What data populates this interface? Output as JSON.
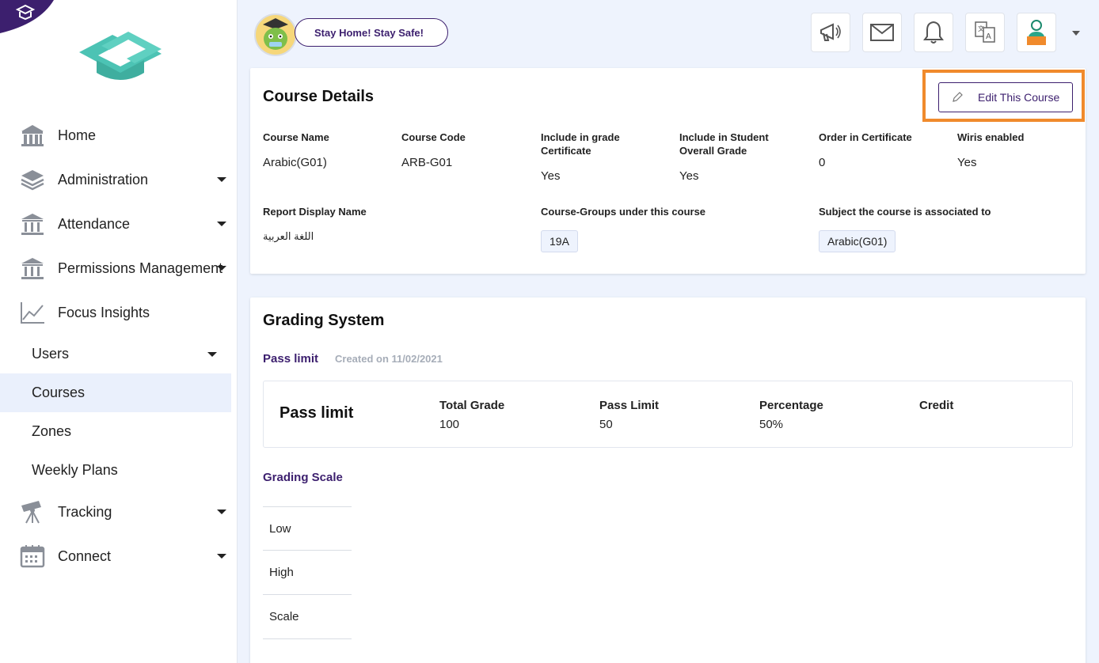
{
  "sidebar": {
    "items": [
      {
        "label": "Home",
        "icon": "bank-icon"
      },
      {
        "label": "Administration",
        "icon": "layers-icon"
      },
      {
        "label": "Attendance",
        "icon": "building-icon"
      },
      {
        "label": "Permissions Management",
        "icon": "building-icon"
      },
      {
        "label": "Focus Insights",
        "icon": "chart-line-icon"
      }
    ],
    "sub_items": [
      "Users",
      "Courses",
      "Zones",
      "Weekly Plans"
    ],
    "active": "Courses",
    "items2": [
      {
        "label": "Tracking",
        "icon": "telescope-icon"
      },
      {
        "label": "Connect",
        "icon": "calendar-icon"
      }
    ]
  },
  "topbar": {
    "banner": "Stay Home! Stay Safe!",
    "icons": [
      "megaphone-icon",
      "mail-icon",
      "bell-icon",
      "translate-icon",
      "user-avatar-icon"
    ]
  },
  "course_details": {
    "title": "Course Details",
    "edit_label": "Edit This Course",
    "fields": {
      "course_name": {
        "label": "Course Name",
        "value": "Arabic(G01)"
      },
      "course_code": {
        "label": "Course Code",
        "value": "ARB-G01"
      },
      "include_grade_cert": {
        "label": "Include in grade Certificate",
        "value": "Yes"
      },
      "include_overall": {
        "label": "Include in Student Overall Grade",
        "value": "Yes"
      },
      "order_cert": {
        "label": "Order in Certificate",
        "value": "0"
      },
      "wiris": {
        "label": "Wiris enabled",
        "value": "Yes"
      },
      "report_name": {
        "label": "Report Display Name",
        "value": "اللغة العربية"
      },
      "course_groups": {
        "label": "Course-Groups under this course",
        "value": "19A"
      },
      "subject": {
        "label": "Subject the course is associated to",
        "value": "Arabic(G01)"
      }
    }
  },
  "grading": {
    "title": "Grading System",
    "pass_limit_link": "Pass limit",
    "created": "Created on 11/02/2021",
    "box": {
      "heading": "Pass limit",
      "columns": [
        {
          "label": "Total Grade",
          "value": "100"
        },
        {
          "label": "Pass Limit",
          "value": "50"
        },
        {
          "label": "Percentage",
          "value": "50%"
        },
        {
          "label": "Credit",
          "value": ""
        }
      ]
    },
    "scale_title": "Grading Scale",
    "scale_rows": [
      "Low",
      "High",
      "Scale"
    ]
  },
  "colors": {
    "accent": "#3c1f6e",
    "highlight": "#f08a2c",
    "teal": "#4cc3b4",
    "active_bg": "#eaf0fc"
  }
}
